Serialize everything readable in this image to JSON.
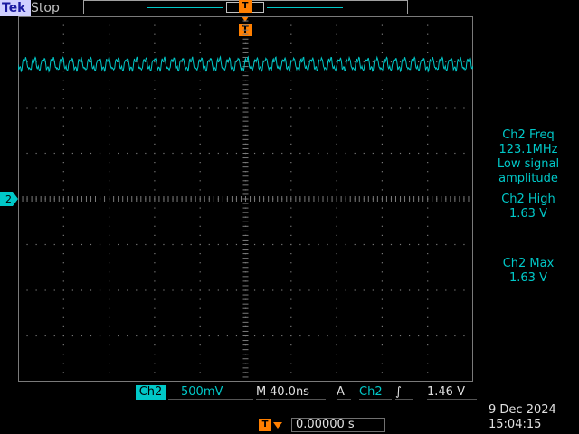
{
  "header": {
    "brand": "Tek",
    "run_state": "Stop",
    "trigger_marker_top": "T"
  },
  "trigger_marker": "T",
  "channel_marker": "2",
  "measurements": [
    {
      "label": "Ch2 Freq",
      "value": "123.1MHz",
      "note": "Low signal",
      "note2": "amplitude"
    },
    {
      "label": "Ch2 High",
      "value": "1.63 V"
    },
    {
      "label": "Ch2 Max",
      "value": "1.63 V"
    }
  ],
  "status": {
    "channel": "Ch2",
    "volts_per_div": "500mV",
    "timebase_prefix": "M",
    "timebase": "40.0ns",
    "trigger_mode": "A",
    "trigger_source": "Ch2",
    "trigger_slope": "∫",
    "trigger_level": "1.46 V"
  },
  "trigger_position": {
    "icon": "T",
    "value": "0.00000 s"
  },
  "datetime": {
    "date": "9 Dec  2024",
    "time": "15:04:15"
  },
  "colors": {
    "trace": "#00c8c8",
    "trigger": "#ff7f00",
    "grid": "#7a7a7a"
  }
}
